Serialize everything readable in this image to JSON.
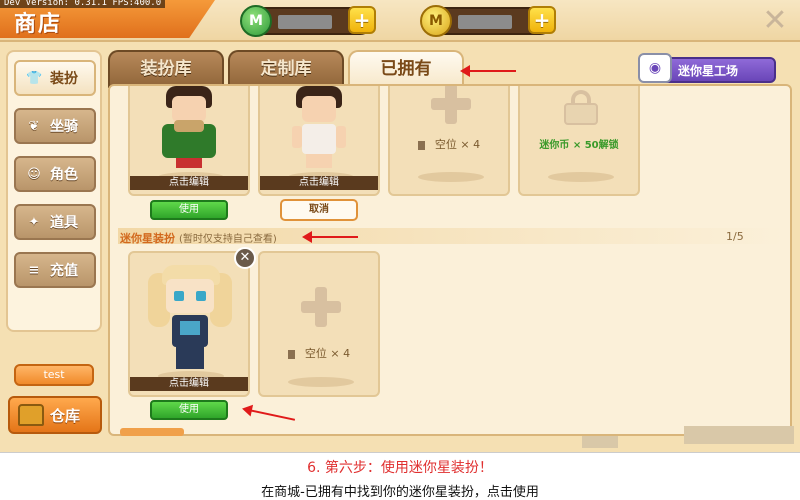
{
  "debug": {
    "text": "Dev Version: 0.31.1   FPS:400.0"
  },
  "header": {
    "title": "商店",
    "close_icon": "close-icon"
  },
  "currency": [
    {
      "name": "mini-bean",
      "coin_letter": "M",
      "color": "#2f9a3a"
    },
    {
      "name": "mini-coin",
      "coin_letter": "M",
      "color": "#d9a51a"
    }
  ],
  "sidebar": {
    "items": [
      {
        "label": "装扮",
        "icon": "shirt-icon",
        "glyph": "👕",
        "active": true
      },
      {
        "label": "坐骑",
        "icon": "mount-icon",
        "glyph": "❦"
      },
      {
        "label": "角色",
        "icon": "character-icon",
        "glyph": "☺"
      },
      {
        "label": "道具",
        "icon": "prop-icon",
        "glyph": "✦"
      },
      {
        "label": "充值",
        "icon": "recharge-icon",
        "glyph": "≡"
      }
    ],
    "test_label": "test",
    "storage_label": "仓库"
  },
  "tabs": [
    {
      "label": "装扮库"
    },
    {
      "label": "定制库"
    },
    {
      "label": "已拥有",
      "active": true
    }
  ],
  "workshop": {
    "label": "迷你星工场"
  },
  "owned": {
    "cards": [
      {
        "type": "skin",
        "edit_label": "点击编辑",
        "action_label": "使用"
      },
      {
        "type": "skin",
        "edit_label": "点击编辑",
        "action_label": "取消"
      },
      {
        "type": "empty",
        "slot_label": "空位 × 4"
      },
      {
        "type": "locked",
        "unlock_label": "迷你币 × 50解锁"
      }
    ]
  },
  "mini_star": {
    "section_title": "迷你星装扮",
    "section_sub": "(暂时仅支持自己查看)",
    "page": "1/5",
    "cards": [
      {
        "type": "skin",
        "edit_label": "点击编辑",
        "action_label": "使用"
      },
      {
        "type": "empty",
        "slot_label": "空位 × 4"
      }
    ]
  },
  "caption": {
    "step": "6. 第六步：使用迷你星装扮！",
    "desc": "在商城-已拥有中找到你的迷你星装扮，点击使用"
  }
}
